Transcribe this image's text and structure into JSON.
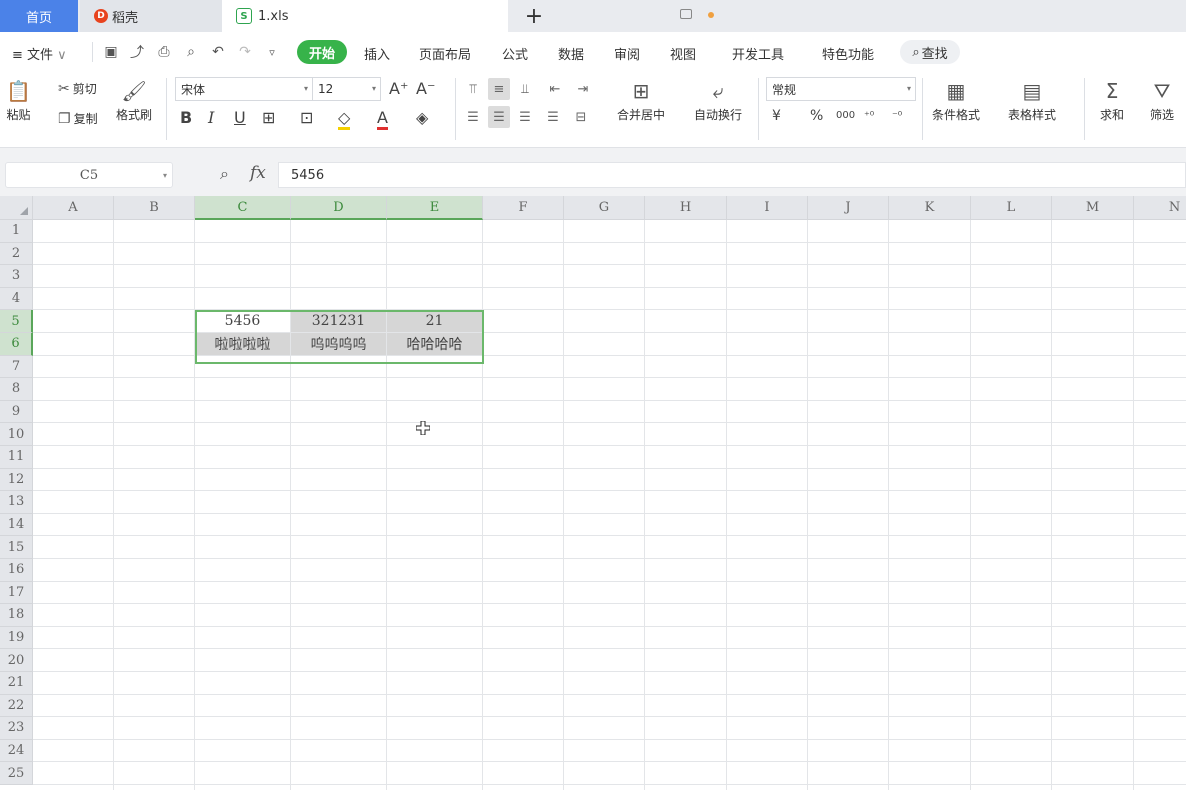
{
  "tabs": {
    "home": "首页",
    "docer": "稻壳",
    "file": "1.xls",
    "add_label": "+"
  },
  "menu": {
    "file_label": "文件",
    "items": [
      "开始",
      "插入",
      "页面布局",
      "公式",
      "数据",
      "审阅",
      "视图",
      "开发工具",
      "特色功能"
    ],
    "search_label": "查找"
  },
  "ribbon": {
    "paste": "粘贴",
    "cut": "剪切",
    "copy": "复制",
    "format_painter": "格式刷",
    "font_name": "宋体",
    "font_size": "12",
    "merge_center": "合并居中",
    "wrap_text": "自动换行",
    "number_format": "常规",
    "currency_symbol": "¥",
    "percent_symbol": "%",
    "thousands_symbol": "000",
    "conditional_format": "条件格式",
    "table_style": "表格样式",
    "sum": "求和",
    "filter": "筛选"
  },
  "formula_bar": {
    "cell_ref": "C5",
    "fx_label": "fx",
    "value": "5456"
  },
  "sheet": {
    "columns": [
      "A",
      "B",
      "C",
      "D",
      "E",
      "F",
      "G",
      "H",
      "I",
      "J",
      "K",
      "L",
      "M",
      "N"
    ],
    "selected_columns": [
      "C",
      "D",
      "E"
    ],
    "rows": [
      "1",
      "2",
      "3",
      "4",
      "5",
      "6",
      "7",
      "8",
      "9",
      "10",
      "11",
      "12",
      "13",
      "14",
      "15",
      "16",
      "17",
      "18",
      "19",
      "20",
      "21",
      "22",
      "23",
      "24",
      "25"
    ],
    "selected_rows": [
      "5",
      "6"
    ],
    "cells": {
      "C5": "5456",
      "D5": "321231",
      "E5": "21",
      "C6": "啦啦啦啦",
      "D6": "呜呜呜呜",
      "E6": "哈哈哈哈"
    },
    "active_cell": "C5"
  },
  "colors": {
    "accent_green": "#37b34a",
    "home_tab_blue": "#4b82e8",
    "selection_border": "#6bb86b",
    "selection_fill": "#d6d6d6"
  }
}
